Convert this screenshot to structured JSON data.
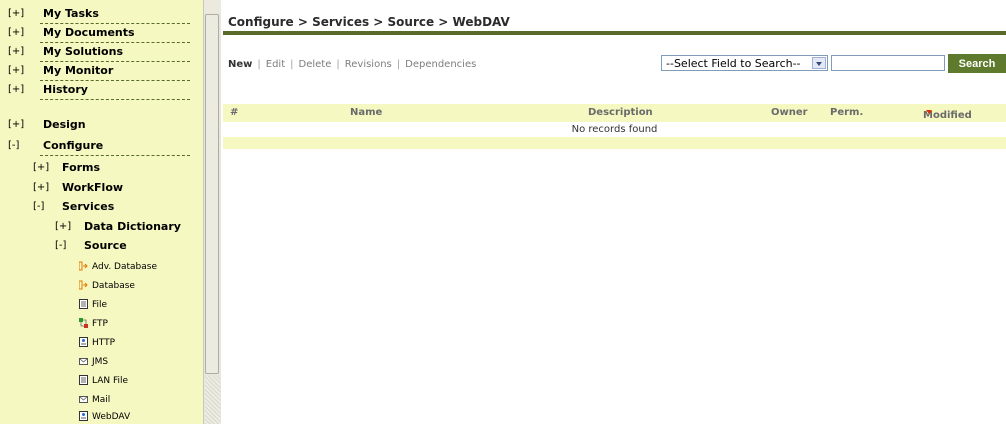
{
  "sidebar": {
    "top_items": [
      {
        "toggle": "[+]",
        "label": "My Tasks"
      },
      {
        "toggle": "[+]",
        "label": "My Documents"
      },
      {
        "toggle": "[+]",
        "label": "My Solutions"
      },
      {
        "toggle": "[+]",
        "label": "My Monitor"
      },
      {
        "toggle": "[+]",
        "label": "History"
      },
      {
        "toggle": "[+]",
        "label": "Design"
      },
      {
        "toggle": "[-]",
        "label": "Configure"
      }
    ],
    "configure_children": [
      {
        "toggle": "[+]",
        "label": "Forms"
      },
      {
        "toggle": "[+]",
        "label": "WorkFlow"
      },
      {
        "toggle": "[-]",
        "label": "Services"
      }
    ],
    "services_children": [
      {
        "toggle": "[+]",
        "label": "Data Dictionary"
      },
      {
        "toggle": "[-]",
        "label": "Source"
      }
    ],
    "source_leaves": [
      {
        "icon": "database-connector-icon",
        "label": "Adv. Database"
      },
      {
        "icon": "database-connector-icon",
        "label": "Database"
      },
      {
        "icon": "file-icon",
        "label": "File"
      },
      {
        "icon": "ftp-icon",
        "label": "FTP"
      },
      {
        "icon": "web-page-icon",
        "label": "HTTP"
      },
      {
        "icon": "envelope-icon",
        "label": "JMS"
      },
      {
        "icon": "file-icon",
        "label": "LAN File"
      },
      {
        "icon": "envelope-icon",
        "label": "Mail"
      },
      {
        "icon": "web-page-icon",
        "label": "WebDAV"
      }
    ]
  },
  "main": {
    "breadcrumb": "Configure > Services > Source > WebDAV",
    "actions": {
      "new": "New",
      "edit": "Edit",
      "delete": "Delete",
      "revisions": "Revisions",
      "dependencies": "Dependencies"
    },
    "search": {
      "select_value": "--Select Field to Search--",
      "input_value": "",
      "button_label": "Search"
    },
    "table": {
      "columns": {
        "num": "#",
        "name": "Name",
        "description": "Description",
        "owner": "Owner",
        "perm": "Perm.",
        "modified": "Modified"
      },
      "empty_message": "No records found"
    }
  },
  "colors": {
    "sidebar_bg": "#f6f8c2",
    "accent": "#5a6a2a",
    "button_bg": "#5e7a2c"
  }
}
